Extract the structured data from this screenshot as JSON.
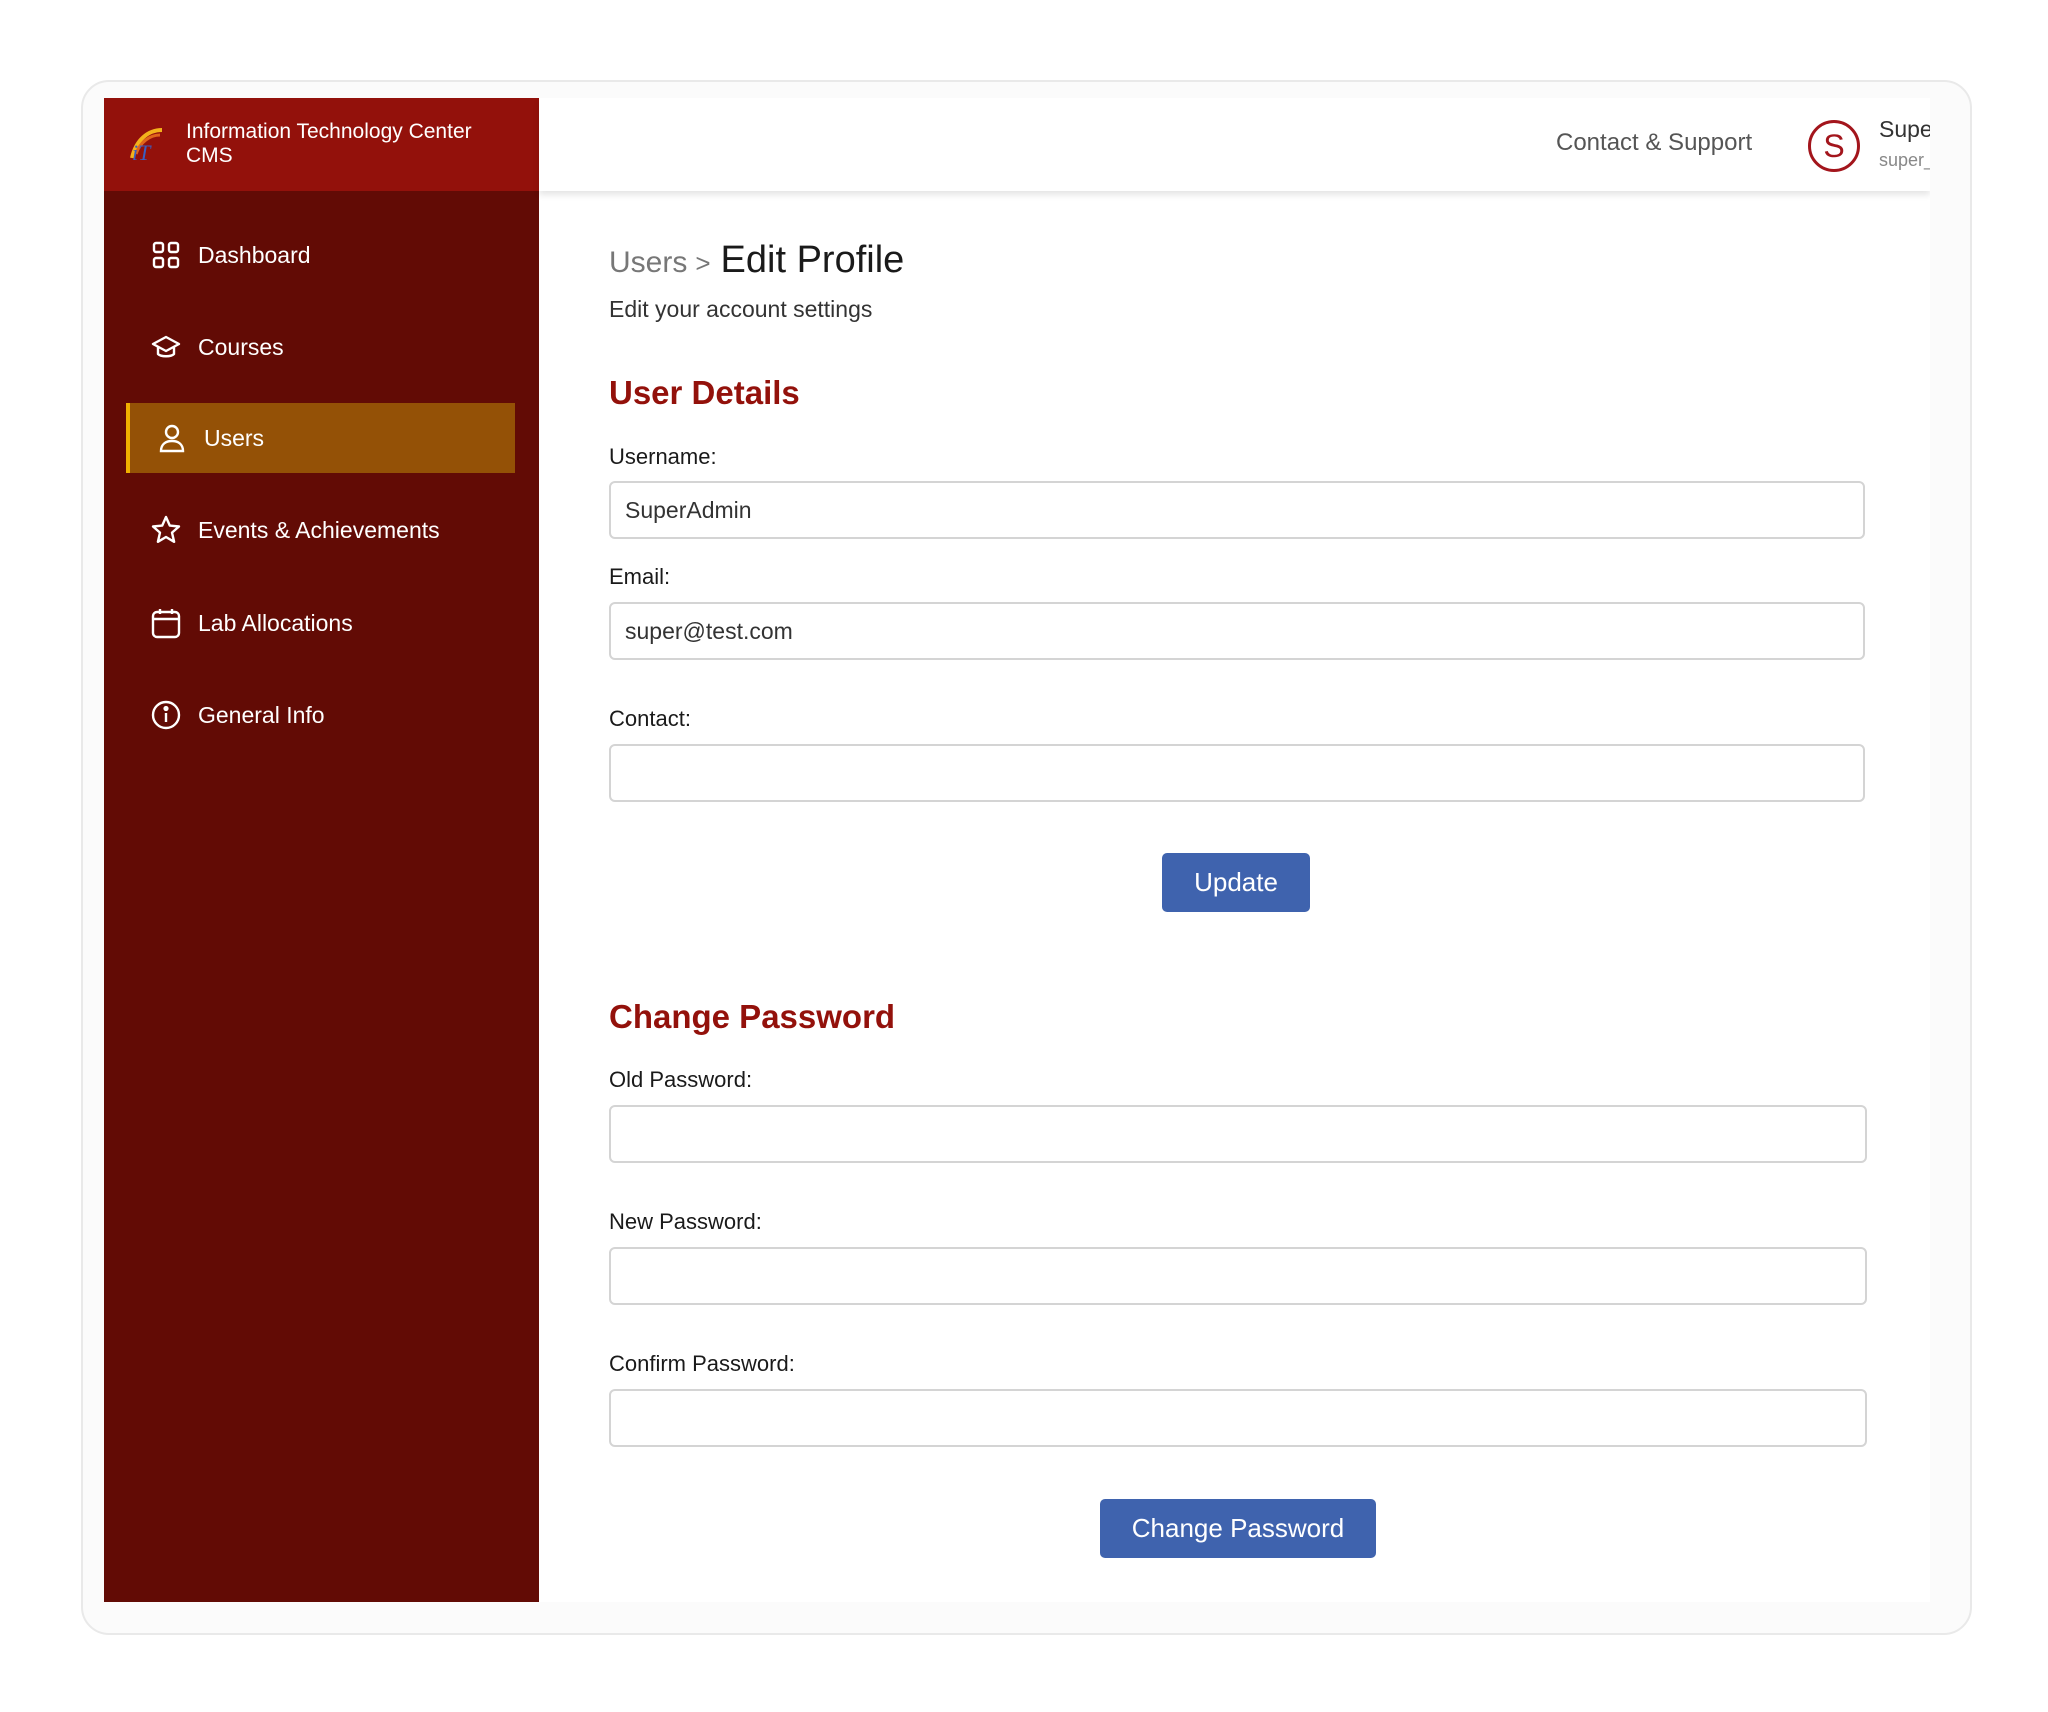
{
  "brand": {
    "line1": "Information Technology Center",
    "line2": "CMS",
    "logo_icon": "itc-logo-icon"
  },
  "sidebar": {
    "items": [
      {
        "label": "Dashboard",
        "icon": "grid-icon"
      },
      {
        "label": "Courses",
        "icon": "graduation-cap-icon"
      },
      {
        "label": "Users",
        "icon": "user-icon",
        "active": true
      },
      {
        "label": "Events & Achievements",
        "icon": "star-icon"
      },
      {
        "label": "Lab Allocations",
        "icon": "calendar-icon"
      },
      {
        "label": "General Info",
        "icon": "info-icon"
      }
    ]
  },
  "header": {
    "contact_link": "Contact & Support",
    "avatar_letter": "S",
    "user_name": "SuperAdmin",
    "user_handle": "super_admin"
  },
  "page": {
    "breadcrumb_parent": "Users",
    "breadcrumb_separator": ">",
    "title": "Edit Profile",
    "subtitle": "Edit your account settings"
  },
  "user_details": {
    "heading": "User Details",
    "username_label": "Username:",
    "username_value": "SuperAdmin",
    "email_label": "Email:",
    "email_value": "super@test.com",
    "contact_label": "Contact:",
    "contact_value": "",
    "update_button": "Update"
  },
  "change_password": {
    "heading": "Change Password",
    "old_label": "Old Password:",
    "new_label": "New Password:",
    "confirm_label": "Confirm Password:",
    "submit_button": "Change Password"
  },
  "colors": {
    "sidebar_bg": "#620b05",
    "brand_bg": "#93110b",
    "active_item_bg": "#945106",
    "accent_red": "#93110b",
    "button_blue": "#3f63ae"
  }
}
